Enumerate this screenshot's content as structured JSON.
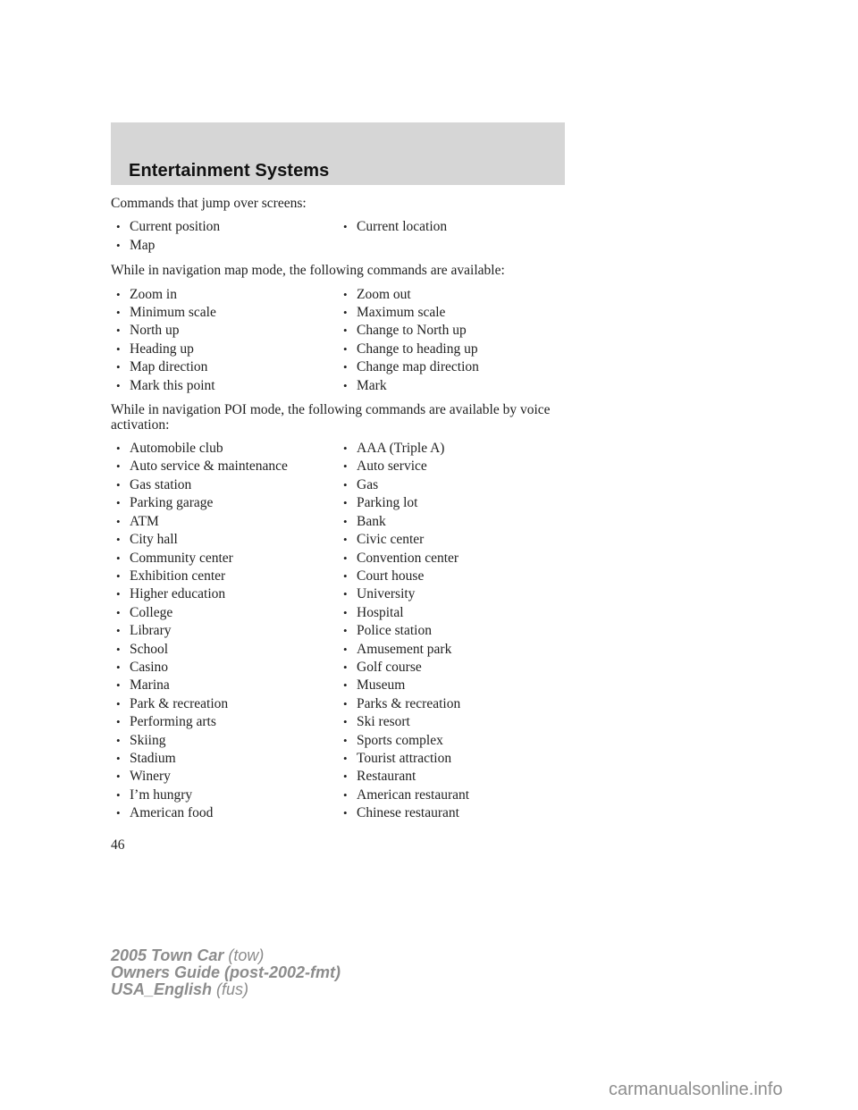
{
  "header": {
    "title": "Entertainment Systems",
    "background": "#d6d6d6"
  },
  "sections": [
    {
      "intro": "Commands that jump over screens:",
      "items": [
        [
          "Current position",
          "Current location"
        ],
        [
          "Map",
          ""
        ]
      ]
    },
    {
      "intro": "While in navigation map mode, the following commands are available:",
      "items": [
        [
          "Zoom in",
          "Zoom out"
        ],
        [
          "Minimum scale",
          "Maximum scale"
        ],
        [
          "North up",
          "Change to North up"
        ],
        [
          "Heading up",
          "Change to heading up"
        ],
        [
          "Map direction",
          "Change map direction"
        ],
        [
          "Mark this point",
          "Mark"
        ]
      ]
    },
    {
      "intro": "While in navigation POI mode, the following commands are available by voice activation:",
      "items": [
        [
          "Automobile club",
          "AAA (Triple A)"
        ],
        [
          "Auto service & maintenance",
          "Auto service"
        ],
        [
          "Gas station",
          "Gas"
        ],
        [
          "Parking garage",
          "Parking lot"
        ],
        [
          "ATM",
          "Bank"
        ],
        [
          "City hall",
          "Civic center"
        ],
        [
          "Community center",
          "Convention center"
        ],
        [
          "Exhibition center",
          "Court house"
        ],
        [
          "Higher education",
          "University"
        ],
        [
          "College",
          "Hospital"
        ],
        [
          "Library",
          "Police station"
        ],
        [
          "School",
          "Amusement park"
        ],
        [
          "Casino",
          "Golf course"
        ],
        [
          "Marina",
          "Museum"
        ],
        [
          "Park & recreation",
          "Parks & recreation"
        ],
        [
          "Performing arts",
          "Ski resort"
        ],
        [
          "Skiing",
          "Sports complex"
        ],
        [
          "Stadium",
          "Tourist attraction"
        ],
        [
          "Winery",
          "Restaurant"
        ],
        [
          "I’m hungry",
          "American restaurant"
        ],
        [
          "American food",
          "Chinese restaurant"
        ]
      ]
    }
  ],
  "bullet_glyph": "•",
  "page_number": "46",
  "footer": {
    "line1_bold": "2005 Town Car",
    "line1_light": " (tow)",
    "line2_bold": "Owners Guide (post-2002-fmt)",
    "line3_bold": "USA_English",
    "line3_light": " (fus)",
    "color": "#8c8c8c"
  },
  "watermark": "carmanualsonline.info"
}
